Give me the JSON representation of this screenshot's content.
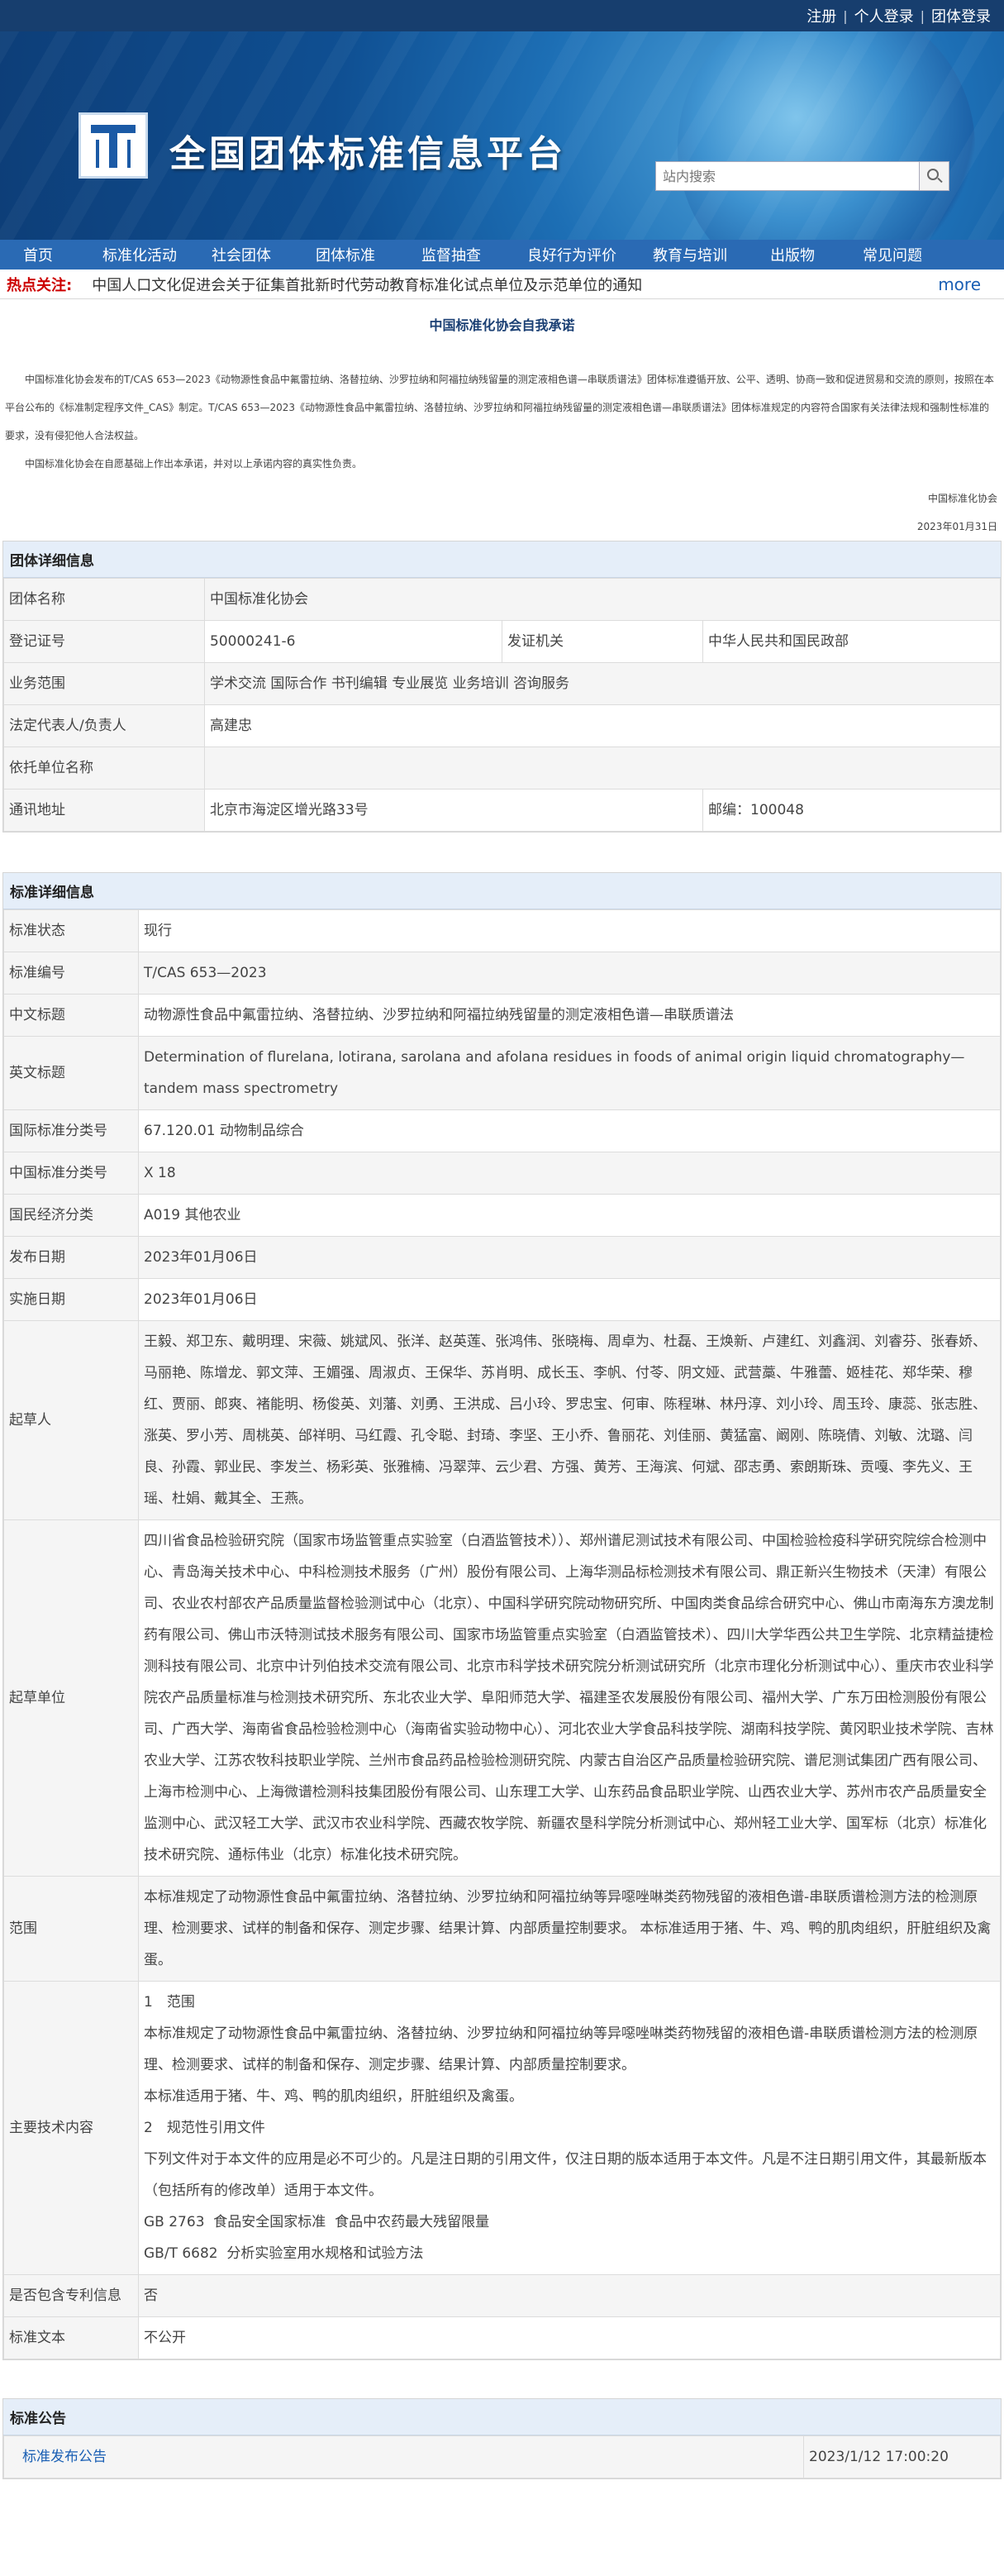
{
  "topbar": {
    "links": [
      "注册",
      "个人登录",
      "团体登录"
    ]
  },
  "header": {
    "site_title": "全国团体标准信息平台",
    "search_placeholder": "站内搜索"
  },
  "nav": [
    "首页",
    "标准化活动",
    "社会团体",
    "团体标准",
    "监督抽查",
    "良好行为评价",
    "教育与培训",
    "出版物",
    "常见问题"
  ],
  "hot": {
    "label": "热点关注:",
    "news": "中国人口文化促进会关于征集首批新时代劳动教育标准化试点单位及示范单位的通知",
    "more": "more"
  },
  "commitment": {
    "title": "中国标准化协会自我承诺",
    "p1": "中国标准化协会发布的T/CAS 653—2023《动物源性食品中氟雷拉纳、洛替拉纳、沙罗拉纳和阿福拉纳残留量的测定液相色谱—串联质谱法》团体标准遵循开放、公平、透明、协商一致和促进贸易和交流的原则，按照在本平台公布的《标准制定程序文件_CAS》制定。T/CAS 653—2023《动物源性食品中氟雷拉纳、洛替拉纳、沙罗拉纳和阿福拉纳残留量的测定液相色谱—串联质谱法》团体标准规定的内容符合国家有关法律法规和强制性标准的要求，没有侵犯他人合法权益。",
    "p2": "中国标准化协会在自愿基础上作出本承诺，并对以上承诺内容的真实性负责。",
    "sign": "中国标准化协会",
    "date": "2023年01月31日"
  },
  "org": {
    "header": "团体详细信息",
    "name_k": "团体名称",
    "name_v": "中国标准化协会",
    "reg_k": "登记证号",
    "reg_v": "50000241-6",
    "issuer_k": "发证机关",
    "issuer_v": "中华人民共和国民政部",
    "scope_k": "业务范围",
    "scope_v": "学术交流 国际合作 书刊编辑 专业展览 业务培训 咨询服务",
    "rep_k": "法定代表人/负责人",
    "rep_v": "高建忠",
    "dep_k": "依托单位名称",
    "dep_v": "",
    "addr_k": "通讯地址",
    "addr_v": "北京市海淀区增光路33号",
    "zip_v": "邮编：100048"
  },
  "standard": {
    "header": "标准详细信息",
    "rows": [
      {
        "k": "标准状态",
        "v": "现行"
      },
      {
        "k": "标准编号",
        "v": "T/CAS 653—2023"
      },
      {
        "k": "中文标题",
        "v": "动物源性食品中氟雷拉纳、洛替拉纳、沙罗拉纳和阿福拉纳残留量的测定液相色谱—串联质谱法"
      },
      {
        "k": "英文标题",
        "v": "Determination of flurelana, lotirana, sarolana and afolana residues in foods of animal origin liquid chromatography—tandem mass spectrometry"
      },
      {
        "k": "国际标准分类号",
        "v": "67.120.01 动物制品综合"
      },
      {
        "k": "中国标准分类号",
        "v": "X 18"
      },
      {
        "k": "国民经济分类",
        "v": "A019 其他农业"
      },
      {
        "k": "发布日期",
        "v": "2023年01月06日"
      },
      {
        "k": "实施日期",
        "v": "2023年01月06日"
      },
      {
        "k": "起草人",
        "v": "王毅、郑卫东、戴明理、宋薇、姚斌风、张洋、赵英莲、张鸿伟、张晓梅、周卓为、杜磊、王焕新、卢建红、刘鑫润、刘睿芬、张春娇、马丽艳、陈增龙、郭文萍、王媚强、周淑贞、王保华、苏肖明、成长玉、李帆、付苓、阴文娅、武营藁、牛雅蕾、姬桂花、郑华荣、穆红、贾丽、郎爽、褚能明、杨俊英、刘藩、刘勇、王洪成、吕小玲、罗忠宝、何审、陈程琳、林丹淳、刘小玲、周玉玲、康蕊、张志胜、涨英、罗小芳、周桃英、邰祥明、马红霞、孔令聪、封琦、李坚、王小乔、鲁丽花、刘佳丽、黄猛富、阚刚、陈晓倩、刘敏、沈璐、闫良、孙霞、郭业民、李发兰、杨彩英、张雅楠、冯翠萍、云少君、方强、黄芳、王海滨、何斌、邵志勇、索朗斯珠、贡嘎、李先义、王瑶、杜娟、戴其全、王燕。"
      },
      {
        "k": "起草单位",
        "v": "四川省食品检验研究院（国家市场监管重点实验室（白酒监管技术））、郑州谱尼测试技术有限公司、中国检验检疫科学研究院综合检测中心、青岛海关技术中心、中科检测技术服务（广州）股份有限公司、上海华测品标检测技术有限公司、鼎正新兴生物技术（天津）有限公司、农业农村部农产品质量监督检验测试中心（北京）、中国科学研究院动物研究所、中国肉类食品综合研究中心、佛山市南海东方澳龙制药有限公司、佛山市沃特测试技术服务有限公司、国家市场监管重点实验室（白酒监管技术）、四川大学华西公共卫生学院、北京精益捷检测科技有限公司、北京中计列伯技术交流有限公司、北京市科学技术研究院分析测试研究所（北京市理化分析测试中心）、重庆市农业科学院农产品质量标准与检测技术研究所、东北农业大学、阜阳师范大学、福建圣农发展股份有限公司、福州大学、广东万田检测股份有限公司、广西大学、海南省食品检验检测中心（海南省实验动物中心）、河北农业大学食品科技学院、湖南科技学院、黄冈职业技术学院、吉林农业大学、江苏农牧科技职业学院、兰州市食品药品检验检测研究院、内蒙古自治区产品质量检验研究院、谱尼测试集团广西有限公司、上海市检测中心、上海微谱检测科技集团股份有限公司、山东理工大学、山东药品食品职业学院、山西农业大学、苏州市农产品质量安全监测中心、武汉轻工大学、武汉市农业科学院、西藏农牧学院、新疆农垦科学院分析测试中心、郑州轻工业大学、国军标（北京）标准化技术研究院、通标伟业（北京）标准化技术研究院。"
      },
      {
        "k": "范围",
        "v": "本标准规定了动物源性食品中氟雷拉纳、洛替拉纳、沙罗拉纳和阿福拉纳等异噁唑啉类药物残留的液相色谱-串联质谱检测方法的检测原理、检测要求、试样的制备和保存、测定步骤、结果计算、内部质量控制要求。 本标准适用于猪、牛、鸡、鸭的肌肉组织，肝脏组织及禽蛋。"
      },
      {
        "k": "主要技术内容",
        "lines": [
          "1　范围",
          "本标准规定了动物源性食品中氟雷拉纳、洛替拉纳、沙罗拉纳和阿福拉纳等异噁唑啉类药物残留的液相色谱-串联质谱检测方法的检测原理、检测要求、试样的制备和保存、测定步骤、结果计算、内部质量控制要求。",
          "本标准适用于猪、牛、鸡、鸭的肌肉组织，肝脏组织及禽蛋。",
          "2　规范性引用文件",
          "下列文件对于本文件的应用是必不可少的。凡是注日期的引用文件，仅注日期的版本适用于本文件。凡是不注日期引用文件，其最新版本（包括所有的修改单）适用于本文件。",
          "GB 2763  食品安全国家标准  食品中农药最大残留限量",
          "GB/T 6682  分析实验室用水规格和试验方法"
        ]
      },
      {
        "k": "是否包含专利信息",
        "v": "否"
      },
      {
        "k": "标准文本",
        "v": "不公开"
      }
    ]
  },
  "announcement": {
    "header": "标准公告",
    "link": "标准发布公告",
    "time": "2023/1/12 17:00:20"
  }
}
